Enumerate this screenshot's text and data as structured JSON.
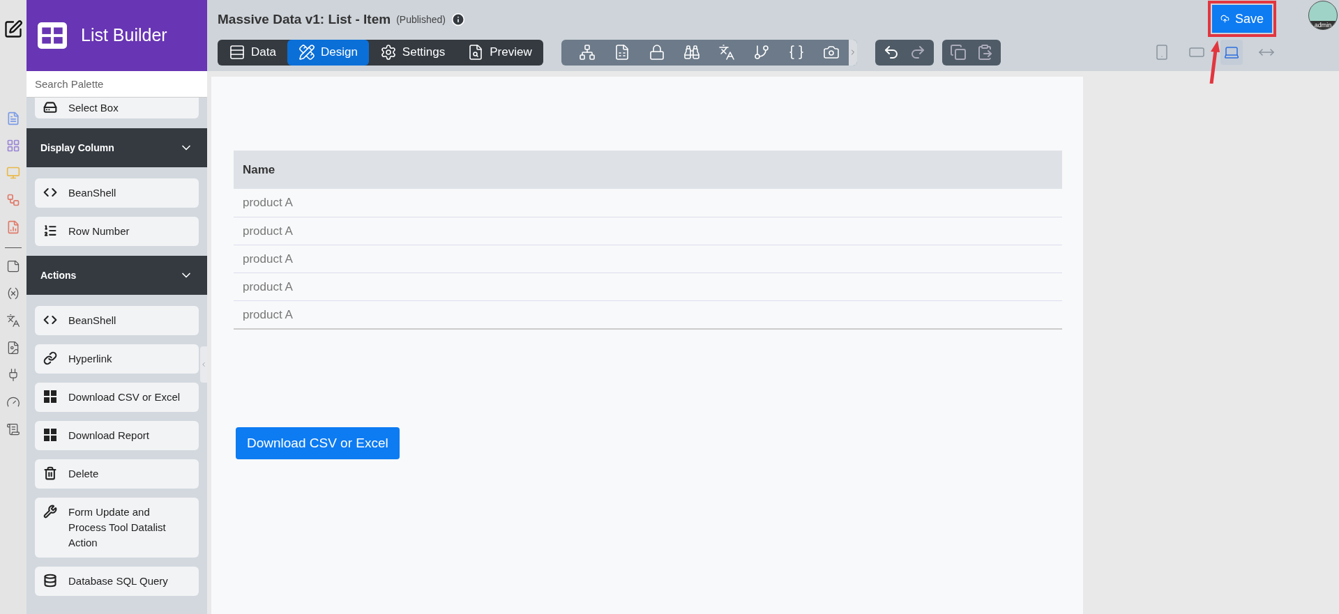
{
  "sidebar": {
    "title": "List Builder",
    "search": {
      "placeholder": "Search Palette"
    },
    "sections": [
      {
        "items": [
          "Select Box"
        ]
      },
      {
        "title": "Display Column",
        "expanded": true,
        "items": [
          "BeanShell",
          "Row Number"
        ]
      },
      {
        "title": "Actions",
        "expanded": true,
        "items": [
          "BeanShell",
          "Hyperlink",
          "Download CSV or Excel",
          "Download Report",
          "Delete",
          "Form Update and Process Tool Datalist Action",
          "Database SQL Query"
        ]
      }
    ]
  },
  "header": {
    "title": "Massive Data v1: List - Item",
    "status": "(Published)",
    "tabs": [
      {
        "label": "Data",
        "selected": false
      },
      {
        "label": "Design",
        "selected": true
      },
      {
        "label": "Settings",
        "selected": false
      },
      {
        "label": "Preview",
        "selected": false
      }
    ],
    "devices": [
      {
        "selected": false
      },
      {
        "selected": false
      },
      {
        "selected": true
      },
      {
        "selected": false
      }
    ],
    "save": "Save",
    "user": "admin"
  },
  "table": {
    "columns": [
      "Name"
    ],
    "rows": [
      [
        "product A"
      ],
      [
        "product A"
      ],
      [
        "product A"
      ],
      [
        "product A"
      ],
      [
        "product A"
      ]
    ]
  },
  "action_button": "Download CSV or Excel"
}
